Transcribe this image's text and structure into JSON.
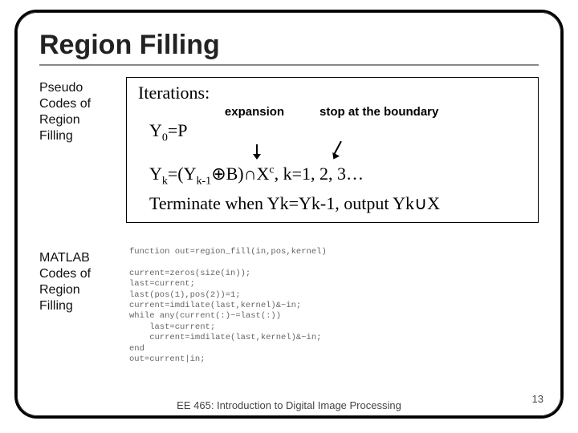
{
  "title": "Region Filling",
  "leftLabel1": "Pseudo Codes of Region Filling",
  "iter": {
    "head": "Iterations:",
    "expansion": "expansion",
    "stop": "stop at the boundary",
    "y0_lhs": "Y",
    "y0_sub": "0",
    "y0_rhs": "=P",
    "yk_a": "Y",
    "yk_a_sub": "k",
    "yk_b": "=(Y",
    "yk_b_sub": "k-1",
    "yk_c": "⊕B)∩X",
    "yk_c_sup": "c",
    "yk_d": ", k=1, 2, 3…",
    "term_a": "Terminate when Y",
    "term_a_sub": "k",
    "term_b": "=Y",
    "term_b_sub": "k-1",
    "term_c": ", output Y",
    "term_c_sub": "k",
    "term_d": "∪X"
  },
  "leftLabel2": "MATLAB Codes of Region Filling",
  "code": "function out=region_fill(in,pos,kernel)\n\ncurrent=zeros(size(in));\nlast=current;\nlast(pos(1),pos(2))=1;\ncurrent=imdilate(last,kernel)&~in;\nwhile any(current(:)~=last(:))\n    last=current;\n    current=imdilate(last,kernel)&~in;\nend\nout=current|in;",
  "footer": "EE 465: Introduction to Digital Image Processing",
  "pageNum": "13"
}
